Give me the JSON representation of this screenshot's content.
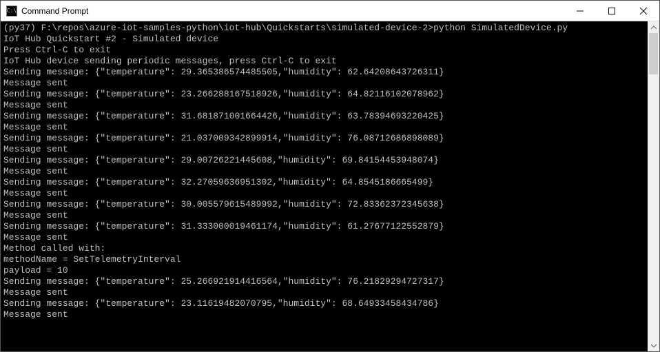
{
  "titlebar": {
    "icon_label": "C:\\",
    "title": "Command Prompt"
  },
  "terminal": {
    "prompt_prefix": "(py37) F:\\repos\\azure-iot-samples-python\\iot-hub\\Quickstarts\\simulated-device-2>",
    "command": "python SimulatedDevice.py",
    "header_line": "IoT Hub Quickstart #2 - Simulated device",
    "exit_hint": "Press Ctrl-C to exit",
    "device_line": "IoT Hub device sending periodic messages, press Ctrl-C to exit",
    "sending_label": "Sending message: ",
    "sent_label": "Message sent",
    "blank": "",
    "method_called_label": "Method called with:",
    "method_name_line": "methodName = SetTelemetryInterval",
    "payload_line": "payload = 10",
    "messages": [
      {
        "temperature": "29.365386574485505",
        "humidity": "62.64208643726311"
      },
      {
        "temperature": "23.266288167518926",
        "humidity": "64.82116102078962"
      },
      {
        "temperature": "31.681871001664426",
        "humidity": "63.78394693220425"
      },
      {
        "temperature": "21.037009342899914",
        "humidity": "76.08712686898089"
      },
      {
        "temperature": "29.00726221445608",
        "humidity": "69.84154453948074"
      },
      {
        "temperature": "32.27059636951302",
        "humidity": "64.8545186665499"
      },
      {
        "temperature": "30.005579615489992",
        "humidity": "72.83362372345638"
      },
      {
        "temperature": "31.333000019461174",
        "humidity": "61.27677122552879"
      }
    ],
    "messages_after": [
      {
        "temperature": "25.266921914416564",
        "humidity": "76.21829294727317"
      },
      {
        "temperature": "23.11619482070795",
        "humidity": "68.64933458434786"
      }
    ]
  }
}
